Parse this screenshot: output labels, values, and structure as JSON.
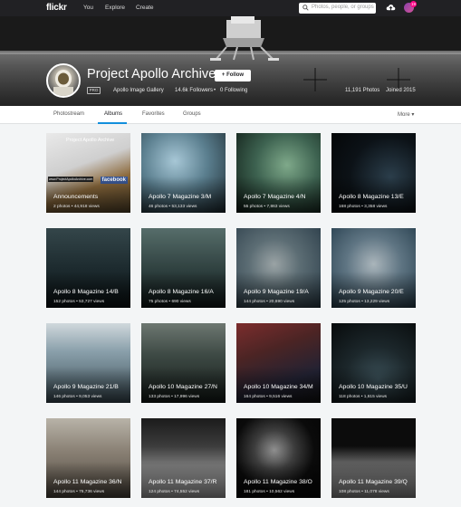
{
  "nav": {
    "logo": "flickr",
    "links": [
      "You",
      "Explore",
      "Create"
    ],
    "search_placeholder": "Photos, people, or groups",
    "notification_count": "19"
  },
  "profile": {
    "name": "Project Apollo Archive",
    "follow_label": "Follow",
    "pro_badge": "PRO",
    "gallery": "Apollo Image Gallery",
    "followers": "14.6k Followers",
    "following": "0 Following",
    "photos": "11,191 Photos",
    "joined": "Joined 2015"
  },
  "tabs": {
    "items": [
      "Photostream",
      "Albums",
      "Favorites",
      "Groups"
    ],
    "active": "Albums",
    "more": "More"
  },
  "albums": [
    {
      "title": "Announcements",
      "photos": "2 photos",
      "views": "44,918 views",
      "overlay": {
        "heading": "Project Apollo Archive",
        "footer": "www.ProjectApolloArchive.com",
        "social": "facebook"
      }
    },
    {
      "title": "Apollo 7 Magazine 3/M",
      "photos": "46 photos",
      "views": "53,133 views"
    },
    {
      "title": "Apollo 7 Magazine 4/N",
      "photos": "55 photos",
      "views": "7,863 views"
    },
    {
      "title": "Apollo 8 Magazine 13/E",
      "photos": "168 photos",
      "views": "3,358 views"
    },
    {
      "title": "Apollo 8 Magazine 14/B",
      "photos": "152 photos",
      "views": "53,727 views"
    },
    {
      "title": "Apollo 8 Magazine 16/A",
      "photos": "75 photos",
      "views": "690 views"
    },
    {
      "title": "Apollo 9 Magazine 19/A",
      "photos": "144 photos",
      "views": "20,690 views"
    },
    {
      "title": "Apollo 9 Magazine 20/E",
      "photos": "125 photos",
      "views": "13,229 views"
    },
    {
      "title": "Apollo 9 Magazine 21/B",
      "photos": "146 photos",
      "views": "9,053 views"
    },
    {
      "title": "Apollo 10 Magazine 27/N",
      "photos": "133 photos",
      "views": "17,996 views"
    },
    {
      "title": "Apollo 10 Magazine 34/M",
      "photos": "164 photos",
      "views": "9,516 views"
    },
    {
      "title": "Apollo 10 Magazine 35/U",
      "photos": "118 photos",
      "views": "1,615 views"
    },
    {
      "title": "Apollo 11 Magazine 36/N",
      "photos": "144 photos",
      "views": "76,736 views"
    },
    {
      "title": "Apollo 11 Magazine 37/R",
      "photos": "124 photos",
      "views": "74,552 views"
    },
    {
      "title": "Apollo 11 Magazine 38/O",
      "photos": "181 photos",
      "views": "10,562 views"
    },
    {
      "title": "Apollo 11 Magazine 39/Q",
      "photos": "108 photos",
      "views": "11,078 views"
    }
  ]
}
